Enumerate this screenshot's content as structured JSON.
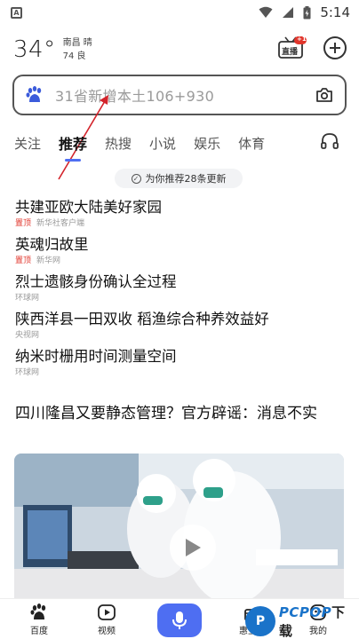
{
  "status_bar": {
    "time": "5:14",
    "app_icon_letter": "A"
  },
  "weather": {
    "temperature": "34°",
    "city": "南昌",
    "condition": "晴",
    "aqi_value": "74",
    "aqi_level": "良"
  },
  "header": {
    "live_label": "直播",
    "live_badge": "+1"
  },
  "search": {
    "placeholder": "31省新增本土106+930"
  },
  "tabs": [
    {
      "label": "关注",
      "active": false
    },
    {
      "label": "推荐",
      "active": true
    },
    {
      "label": "热搜",
      "active": false
    },
    {
      "label": "小说",
      "active": false
    },
    {
      "label": "娱乐",
      "active": false
    },
    {
      "label": "体育",
      "active": false
    }
  ],
  "update_pill": {
    "text": "为你推荐28条更新"
  },
  "news": [
    {
      "title": "共建亚欧大陆美好家园",
      "tag": "置顶",
      "source": "新华社客户端"
    },
    {
      "title": "英魂归故里",
      "tag": "置顶",
      "source": "新华网"
    },
    {
      "title": "烈士遗骸身份确认全过程",
      "tag": "",
      "source": "环球网"
    },
    {
      "title": "陕西洋县一田双收 稻渔综合种养效益好",
      "tag": "",
      "source": "央视网"
    },
    {
      "title": "纳米时栅用时间测量空间",
      "tag": "",
      "source": "环球网"
    }
  ],
  "article": {
    "title": "四川隆昌又要静态管理？官方辟谣：消息不实"
  },
  "bottom_nav": [
    {
      "label": "百度",
      "icon": "baidu-paw-icon"
    },
    {
      "label": "视频",
      "icon": "video-play-icon"
    },
    {
      "label": "惠互动",
      "icon": "gift-icon"
    },
    {
      "label": "我的",
      "icon": "user-icon"
    }
  ],
  "watermark": {
    "text": "PCPOP",
    "suffix": "下载"
  },
  "colors": {
    "accent": "#4e6ef2",
    "top_tag": "#e1352b",
    "annotation_arrow": "#d3232b",
    "watermark": "#1a73c9"
  }
}
